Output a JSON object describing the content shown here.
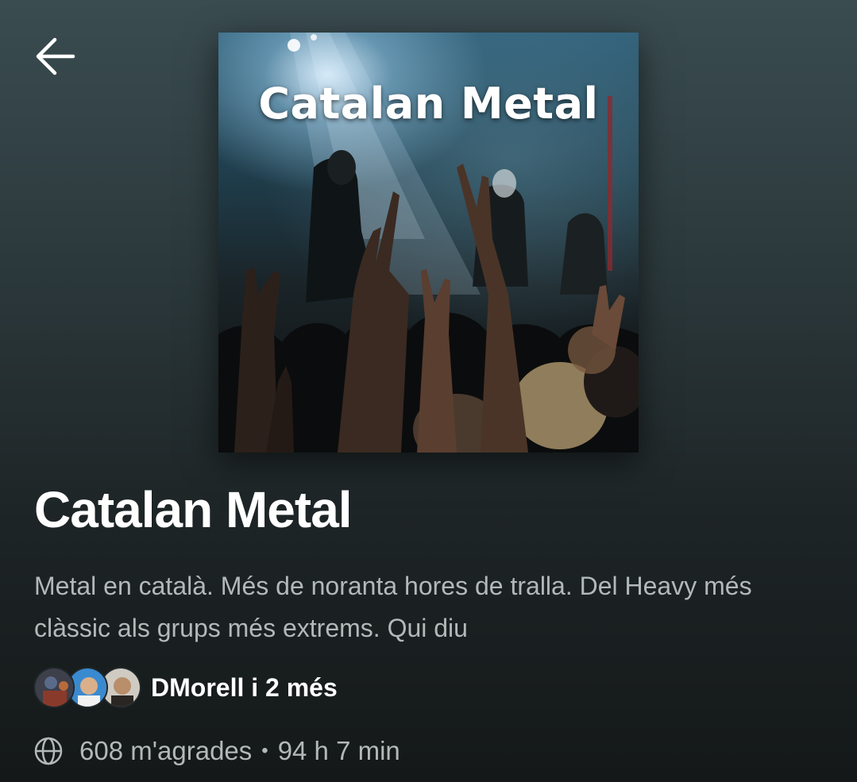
{
  "header": {
    "back_icon": "arrow-left-icon"
  },
  "cover": {
    "title": "Catalan Metal"
  },
  "playlist": {
    "title": "Catalan Metal",
    "description": "Metal en català. Més de noranta hores de tralla. Del Heavy més clàssic als grups més extrems. Qui diu",
    "owners": "DMorell i 2 més",
    "likes": "608 m'agrades",
    "separator": "•",
    "duration": "94 h 7 min",
    "visibility_icon": "globe-icon"
  },
  "colors": {
    "background_top": "#3a4c50",
    "background_bottom": "#141818",
    "text_primary": "#ffffff",
    "text_secondary": "#b3b8b9"
  }
}
